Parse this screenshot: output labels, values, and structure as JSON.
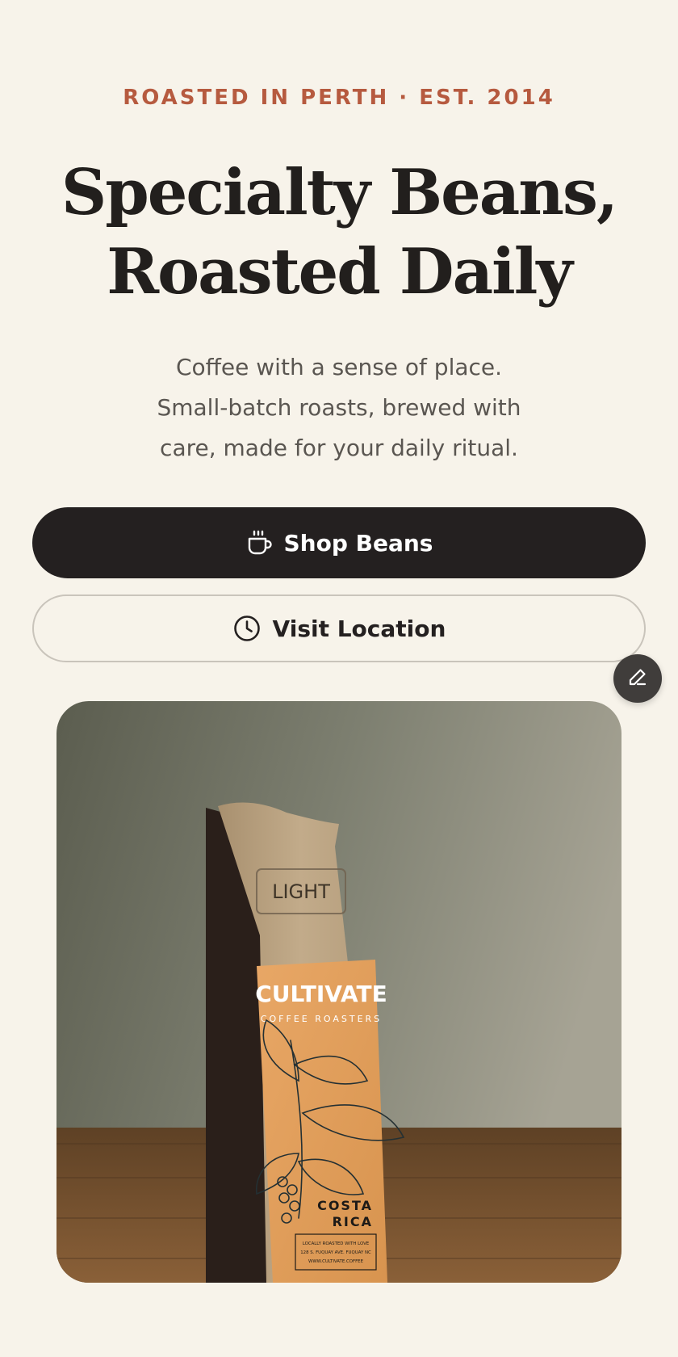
{
  "hero": {
    "eyebrow": "ROASTED IN PERTH · EST. 2014",
    "headline_line1": "Specialty Beans,",
    "headline_line2": "Roasted Daily",
    "subtitle_line1": "Coffee with a sense of place.",
    "subtitle_line2": "Small-batch roasts, brewed with",
    "subtitle_line3": "care, made for your daily ritual."
  },
  "actions": {
    "primary_label": "Shop Beans",
    "primary_icon": "coffee-cup-icon",
    "secondary_label": "Visit Location",
    "secondary_icon": "clock-icon",
    "edit_icon": "pencil-icon"
  },
  "photo": {
    "stamp": "LIGHT",
    "brand": "CULTIVATE",
    "brand_sub": "COFFEE ROASTERS",
    "origin_line1": "COSTA",
    "origin_line2": "RICA",
    "footer_line1": "LOCALLY ROASTED WITH LOVE",
    "footer_line2": "128 S. FUQUAY AVE. FUQUAY NC",
    "footer_line3": "WWW.CULTIVATE.COFFEE"
  },
  "colors": {
    "background": "#f7f3ea",
    "accent": "#b65a3f",
    "primary_button": "#242020",
    "text_dark": "#221f1d",
    "text_muted": "#5a5651"
  }
}
